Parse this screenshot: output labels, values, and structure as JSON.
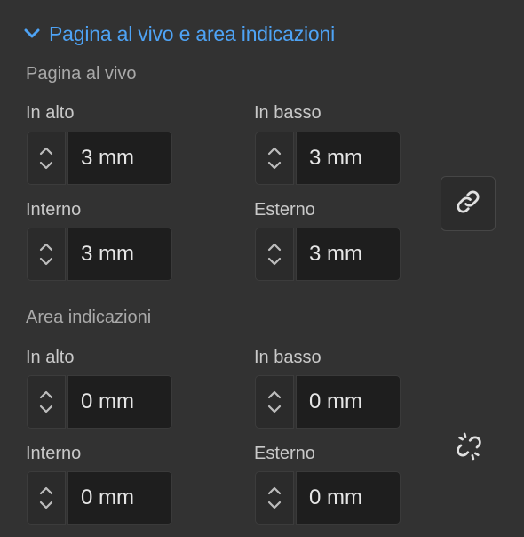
{
  "header": {
    "title": "Pagina al vivo e area indicazioni",
    "accent_color": "#4ea3f5",
    "icon": "chevron-down-icon"
  },
  "bleed": {
    "section_label": "Pagina al vivo",
    "top": {
      "label": "In alto",
      "value": "3 mm"
    },
    "bottom": {
      "label": "In basso",
      "value": "3 mm"
    },
    "inside": {
      "label": "Interno",
      "value": "3 mm"
    },
    "outside": {
      "label": "Esterno",
      "value": "3 mm"
    },
    "link_icon": "link-icon",
    "linked": true
  },
  "slug": {
    "section_label": "Area indicazioni",
    "top": {
      "label": "In alto",
      "value": "0 mm"
    },
    "bottom": {
      "label": "In basso",
      "value": "0 mm"
    },
    "inside": {
      "label": "Interno",
      "value": "0 mm"
    },
    "outside": {
      "label": "Esterno",
      "value": "0 mm"
    },
    "link_icon": "unlink-icon",
    "linked": false
  }
}
